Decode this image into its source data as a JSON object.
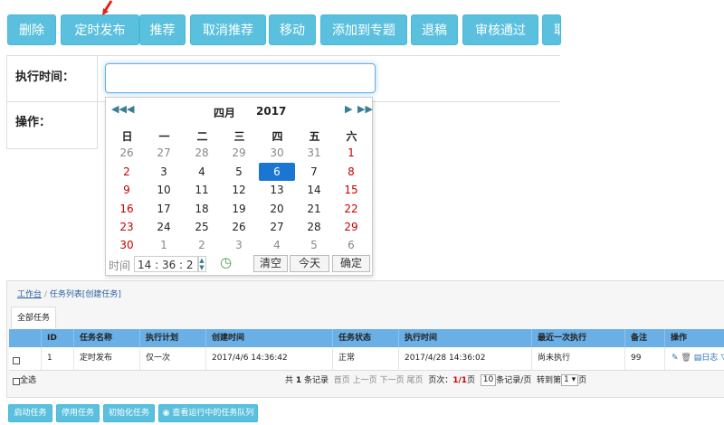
{
  "toolbar": {
    "buttons": [
      "删除",
      "定时发布",
      "推荐",
      "取消推荐",
      "移动",
      "添加到专题",
      "退稿",
      "审核通过",
      "取"
    ]
  },
  "form": {
    "exec_time_label": "执行时间：",
    "exec_time_value": "",
    "operation_label": "操作："
  },
  "calendar": {
    "month": "四月",
    "year": "2017",
    "weekdays": [
      "日",
      "一",
      "二",
      "三",
      "四",
      "五",
      "六"
    ],
    "weeks": [
      [
        "26",
        "27",
        "28",
        "29",
        "30",
        "31",
        "1"
      ],
      [
        "2",
        "3",
        "4",
        "5",
        "6",
        "7",
        "8"
      ],
      [
        "9",
        "10",
        "11",
        "12",
        "13",
        "14",
        "15"
      ],
      [
        "16",
        "17",
        "18",
        "19",
        "20",
        "21",
        "22"
      ],
      [
        "23",
        "24",
        "25",
        "26",
        "27",
        "28",
        "29"
      ],
      [
        "30",
        "1",
        "2",
        "3",
        "4",
        "5",
        "6"
      ]
    ],
    "selected_day": "6",
    "time_label": "时间",
    "time_value": "14 : 36 : 2",
    "clear_label": "清空",
    "today_label": "今天",
    "ok_label": "确定",
    "colors": {
      "selected": "#1a76d2",
      "weekend": "#c00000",
      "other_month": "#888888"
    }
  },
  "task_panel": {
    "breadcrumb_home": "工作台",
    "breadcrumb_sep": "/",
    "breadcrumb_list": "任务列表",
    "breadcrumb_create": "[创建任务]",
    "tab": "全部任务",
    "columns": [
      "ID",
      "任务名称",
      "执行计划",
      "创建时间",
      "任务状态",
      "执行时间",
      "最近一次执行",
      "备注",
      "操作"
    ],
    "rows": [
      {
        "id": "1",
        "name": "定时发布",
        "plan": "仅一次",
        "created": "2017/4/6 14:36:42",
        "status": "正常",
        "exec_time": "2017/4/28 14:36:02",
        "last_exec": "尚未执行",
        "remark": "99",
        "log_label": "日志"
      }
    ],
    "select_all": "全选",
    "pager": {
      "total_prefix": "共",
      "total": "1",
      "total_suffix": "条记录",
      "first": "首页",
      "prev": "上一页",
      "next": "下一页",
      "last": "尾页",
      "page_label": "页次：",
      "page_current": "1/1",
      "page_suffix": "页",
      "per_page": "10",
      "per_page_suffix": "条记录/页",
      "goto_prefix": "转到第",
      "goto_value": "1",
      "goto_suffix": "页"
    },
    "actions": [
      "启动任务",
      "停用任务",
      "初始化任务",
      "查看运行中的任务队列"
    ]
  }
}
